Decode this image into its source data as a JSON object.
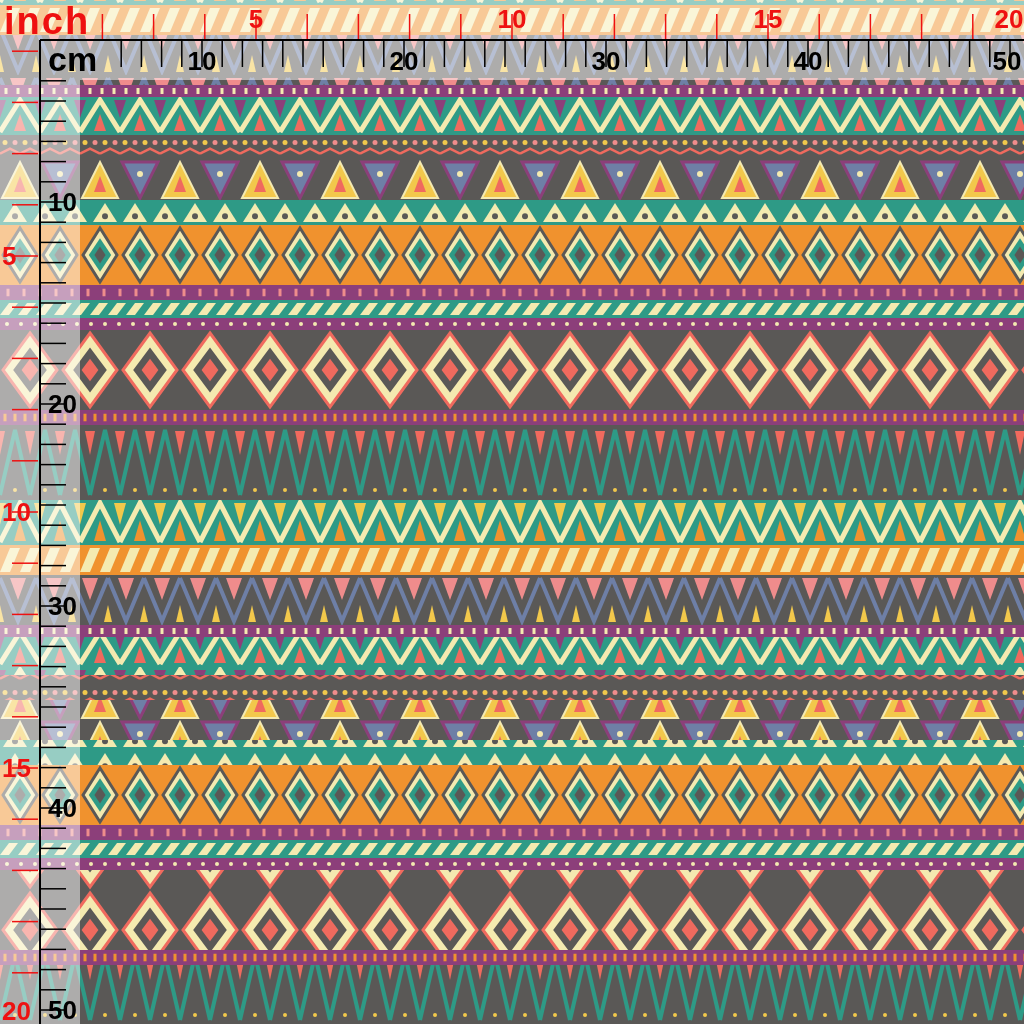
{
  "top_inch_ruler": {
    "unit_label": "inch",
    "labels": [
      "5",
      "10",
      "15",
      "20"
    ]
  },
  "top_cm_ruler": {
    "unit_label": "cm",
    "labels": [
      "10",
      "20",
      "30",
      "40",
      "50"
    ]
  },
  "left_inch_ruler": {
    "labels": [
      "5",
      "10",
      "15",
      "20"
    ]
  },
  "left_cm_ruler": {
    "labels": [
      "10",
      "20",
      "30",
      "40",
      "50"
    ]
  }
}
